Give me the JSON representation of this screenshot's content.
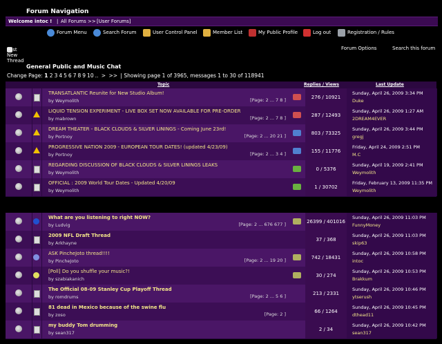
{
  "header": {
    "title": "Forum Navigation"
  },
  "welcome": {
    "text": "Welcome intoc !",
    "breadcrumb_all": "All Forums >> ",
    "breadcrumb_user": "[User Forums]",
    "sep": "|"
  },
  "nav": [
    {
      "label": "Forum Menu",
      "icon": "globe-icon",
      "color": "#4a8ad8"
    },
    {
      "label": "Search Forum",
      "icon": "search-globe-icon",
      "color": "#4a8ad8"
    },
    {
      "label": "User Control Panel",
      "icon": "user-icon",
      "color": "#e0b040"
    },
    {
      "label": "Member List",
      "icon": "members-icon",
      "color": "#e0b040"
    },
    {
      "label": "My Public Profile",
      "icon": "profile-icon",
      "color": "#c03030"
    },
    {
      "label": "Log out",
      "icon": "logout-icon",
      "color": "#d03030"
    },
    {
      "label": "Registration / Rules",
      "icon": "register-icon",
      "color": "#9aa0a8"
    }
  ],
  "actions": {
    "new_thread": "Post New Thread",
    "forum_options": "Forum Options",
    "search_forum": "Search this forum"
  },
  "forum": {
    "title": "General Public and Music Chat"
  },
  "pager": {
    "label": "Change Page:",
    "current": "1",
    "pages": [
      "2",
      "3",
      "4",
      "5",
      "6",
      "7",
      "8",
      "9",
      "10",
      ".."
    ],
    "next": ">",
    ">>": ">>",
    "info": "| Showing page 1 of 3965, messages 1 to 30 of 118941"
  },
  "table": {
    "col_topic": "Topic",
    "col_replies": "Replies / Views",
    "col_last": "Last Update"
  },
  "rows": [
    {
      "title": "TRANSATLANTIC Reunite for New Studio Album!",
      "by": "by Weymolith",
      "pages": "[Page: 2 ... 7 8 ]",
      "replies": "276 / 10921",
      "date": "Sunday, April 26, 2009 3:34 PM",
      "user": "Duke",
      "icon": "doc",
      "ticon": "#d05050",
      "bold": false
    },
    {
      "title": "LIQUID TENSION EXPERIMENT - LIVE BOX SET NOW AVAILABLE FOR PRE-ORDER",
      "by": "by mabrown",
      "pages": "[Page: 2 ... 7 8 ]",
      "replies": "287 / 12493",
      "date": "Sunday, April 26, 2009 1:27 AM",
      "user": "2DREAM4EVER",
      "icon": "warn",
      "ticon": "#d05050",
      "bold": false
    },
    {
      "title": "DREAM THEATER - BLACK CLOUDS & SILVER LININGS - Coming June 23rd!",
      "by": "by Portnoy",
      "pages": "[Page: 2 ... 20 21 ]",
      "replies": "803 / 73325",
      "date": "Sunday, April 26, 2009 3:44 PM",
      "user": "gregj",
      "icon": "warn",
      "ticon": "#5080d0",
      "bold": false
    },
    {
      "title": "PROGRESSIVE NATION 2009 - EUROPEAN TOUR DATES! (updated 4/23/09)",
      "by": "by Portnoy",
      "pages": "[Page: 2 ... 3 4 ]",
      "replies": "155 / 11776",
      "date": "Friday, April 24, 2009 2:51 PM",
      "user": "M.C",
      "icon": "warn",
      "ticon": "#5080d0",
      "bold": false
    },
    {
      "title": "REGARDING DISCUSSION OF BLACK CLOUDS & SILVER LININGS LEAKS",
      "by": "by Weymolith",
      "pages": "",
      "replies": "0 / 5376",
      "date": "Sunday, April 19, 2009 2:41 PM",
      "user": "Weymolith",
      "icon": "doc",
      "ticon": "#6ab040",
      "bold": false
    },
    {
      "title": "OFFICIAL : 2009 World Tour Dates - Updated 4/20/09",
      "by": "by Weymolith",
      "pages": "",
      "replies": "1 / 30702",
      "date": "Friday, February 13, 2009 11:35 PM",
      "user": "Weymolith",
      "icon": "doc",
      "ticon": "#6ab040",
      "bold": false
    },
    {
      "title": "What are you listening to right NOW?",
      "by": "by Ludvig",
      "pages": "[Page: 2 ... 676 677 ]",
      "replies": "26399 / 401016",
      "date": "Sunday, April 26, 2009 11:03 PM",
      "user": "FunnyMoney",
      "icon": "q",
      "ticon": "#b0b060",
      "bold": true
    },
    {
      "title": "2009 NFL Draft Thread",
      "by": "by Arkhayne",
      "pages": "",
      "replies": "37 / 368",
      "date": "Sunday, April 26, 2009 11:03 PM",
      "user": "skip63",
      "icon": "doc",
      "ticon": "",
      "bold": true
    },
    {
      "title": "ASK PincheJoto thread!!!!",
      "by": "by PincheJoto",
      "pages": "[Page: 2 ... 19 20 ]",
      "replies": "742 / 18431",
      "date": "Sunday, April 26, 2009 10:58 PM",
      "user": "intoc",
      "icon": "smile",
      "ticon": "#b0b060",
      "bold": false
    },
    {
      "title": "[Poll] Do you shuffle your music?!",
      "by": "by szabiakanich",
      "pages": "",
      "replies": "30 / 274",
      "date": "Sunday, April 26, 2009 10:53 PM",
      "user": "Brakkum",
      "icon": "bulb",
      "ticon": "#b0b060",
      "bold": false
    },
    {
      "title": "The Official 08-09 Stanley Cup Playoff Thread",
      "by": "by romdrums",
      "pages": "[Page: 2 ... 5 6 ]",
      "replies": "213 / 2331",
      "date": "Sunday, April 26, 2009 10:46 PM",
      "user": "ytserush",
      "icon": "doc",
      "ticon": "",
      "bold": true
    },
    {
      "title": "81 dead in Mexico because of the swine flu",
      "by": "by zoso",
      "pages": "[Page: 2 ]",
      "replies": "66 / 1264",
      "date": "Sunday, April 26, 2009 10:45 PM",
      "user": "dthead11",
      "icon": "doc",
      "ticon": "",
      "bold": true
    },
    {
      "title": "my buddy Tom drumming",
      "by": "by sean317",
      "pages": "",
      "replies": "2 / 34",
      "date": "Sunday, April 26, 2009 10:42 PM",
      "user": "sean317",
      "icon": "doc",
      "ticon": "",
      "bold": true
    }
  ]
}
